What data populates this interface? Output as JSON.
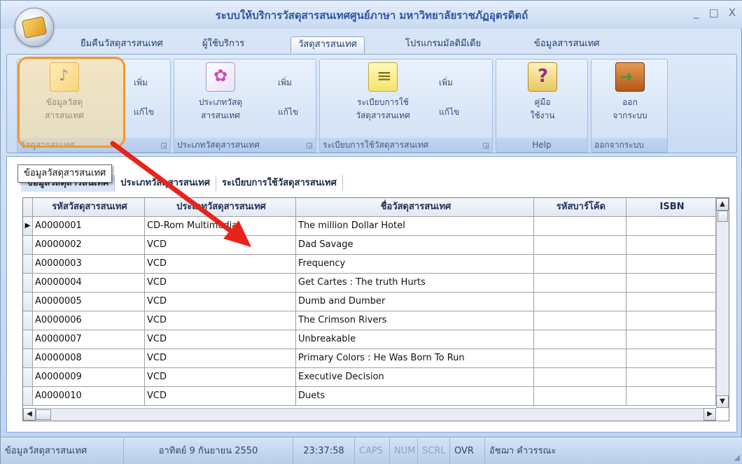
{
  "window": {
    "title": "ระบบให้บริการวัสดุสารสนเทศศูนย์ภาษา มหาวิทยาลัยราชภัฏอุตรดิตถ์",
    "controls": [
      "_",
      "□",
      "X"
    ]
  },
  "menu_tabs": [
    {
      "label": "ยืมคืนวัสดุสารสนเทศ"
    },
    {
      "label": "ผู้ใช้บริการ"
    },
    {
      "label": "วัสดุสารสนเทศ"
    },
    {
      "label": "โปรแกรมมัลติมีเดีย"
    },
    {
      "label": "ข้อมูลสารสนเทศ"
    }
  ],
  "ribbon": {
    "groups": [
      {
        "label": "วัสดุสารสนเทศ",
        "large_label": "ข้อมูลวัสดุ\nสารสนเทศ",
        "add": "เพิ่ม",
        "edit": "แก้ไข",
        "icon": "media-data-icon"
      },
      {
        "label": "ประเภทวัสดุสารสนเทศ",
        "large_label": "ประเภทวัสดุ\nสารสนเทศ",
        "add": "เพิ่ม",
        "edit": "แก้ไข",
        "icon": "category-icon"
      },
      {
        "label": "ระเบียบการใช้วัสดุสารสนเทศ",
        "large_label": "ระเบียบการใช้\nวัสดุสารสนเทศ",
        "add": "เพิ่ม",
        "edit": "แก้ไข",
        "icon": "rules-note-icon"
      },
      {
        "label": "Help",
        "large_label": "คู่มือ\nใช้งาน",
        "icon": "help-book-icon"
      },
      {
        "label": "ออกจากระบบ",
        "large_label": "ออก\nจากระบบ",
        "icon": "exit-door-icon"
      }
    ]
  },
  "tooltip": "ข้อมูลวัสดุสารสนเทศ",
  "doc_tabs": [
    "ข้อมูลวัสดุสารสนเทศ",
    "ประเภทวัสดุสารสนเทศ",
    "ระเบียบการใช้วัสดุสารสนเทศ"
  ],
  "grid": {
    "columns": [
      "รหัสวัสดุสารสนเทศ",
      "ประเภทวัสดุสารสนเทศ",
      "ชื่อวัสดุสารสนเทศ",
      "รหัสบาร์โค้ด",
      "ISBN"
    ],
    "rows": [
      [
        "A0000001",
        "CD-Rom Multimedia",
        "The million Dollar Hotel",
        "",
        ""
      ],
      [
        "A0000002",
        "VCD",
        "Dad Savage",
        "",
        ""
      ],
      [
        "A0000003",
        "VCD",
        "Frequency",
        "",
        ""
      ],
      [
        "A0000004",
        "VCD",
        "Get Cartes : The truth Hurts",
        "",
        ""
      ],
      [
        "A0000005",
        "VCD",
        "Dumb and Dumber",
        "",
        ""
      ],
      [
        "A0000006",
        "VCD",
        "The Crimson Rivers",
        "",
        ""
      ],
      [
        "A0000007",
        "VCD",
        "Unbreakable",
        "",
        ""
      ],
      [
        "A0000008",
        "VCD",
        "Primary Colors : He Was Born To Run",
        "",
        ""
      ],
      [
        "A0000009",
        "VCD",
        "Executive Decision",
        "",
        ""
      ],
      [
        "A0000010",
        "VCD",
        "Duets",
        "",
        ""
      ]
    ],
    "current_row_marker": "▶"
  },
  "statusbar": {
    "section": "ข้อมูลวัสดุสารสนเทศ",
    "date": "อาทิตย์ 9 กันยายน 2550",
    "time": "23:37:58",
    "keys": [
      "CAPS",
      "NUM",
      "SCRL",
      "OVR"
    ],
    "user": "อัชฌา คำวรรณะ"
  },
  "colors": {
    "accent_highlight": "#f09a2b",
    "arrow": "#e8231c",
    "title": "#2e55a0"
  }
}
